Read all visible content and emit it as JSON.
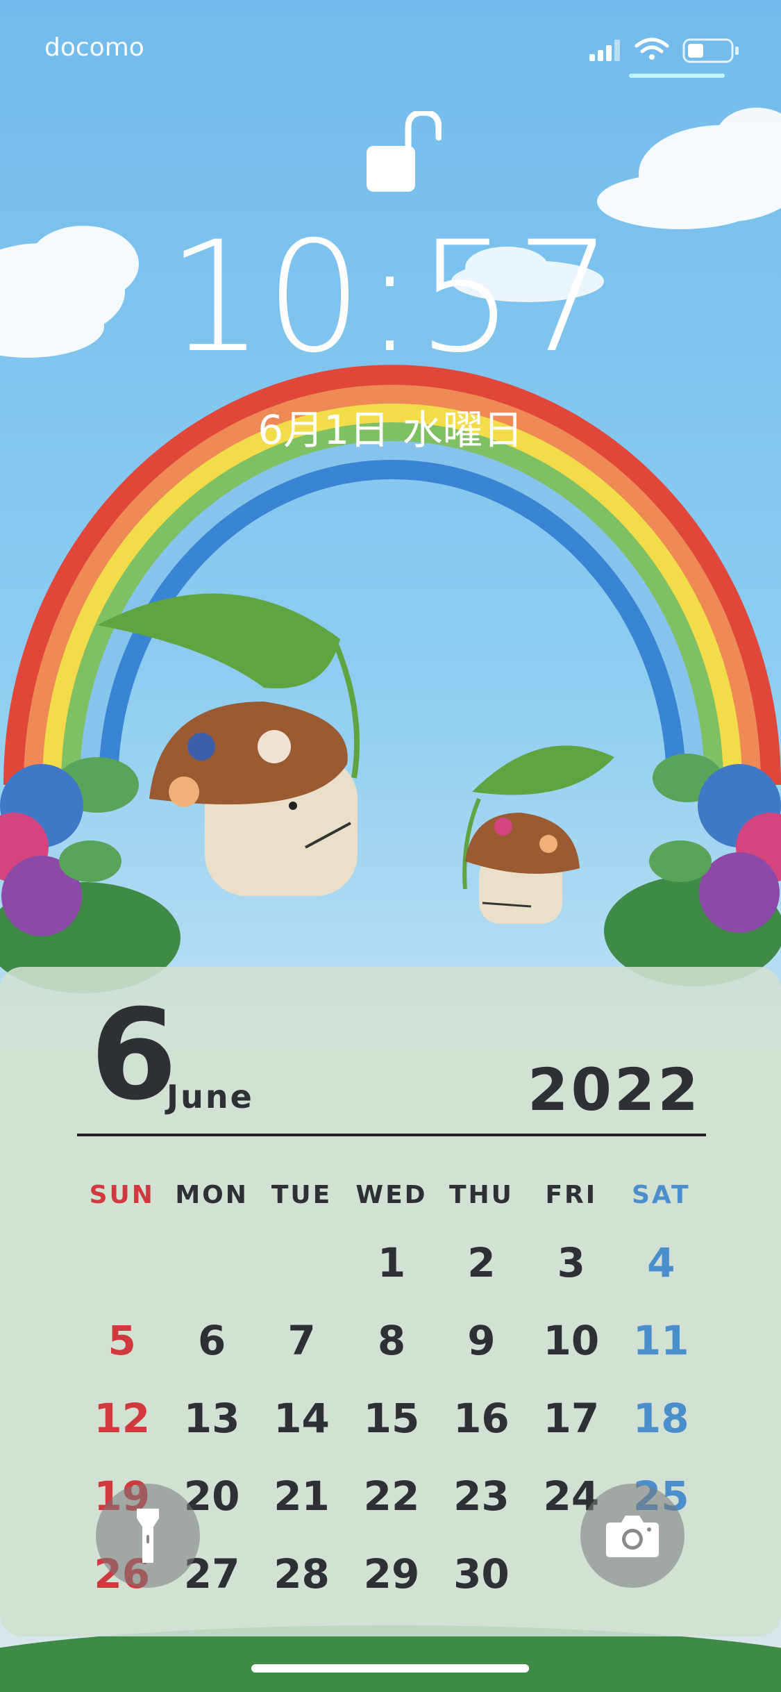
{
  "status_bar": {
    "carrier": "docomo",
    "signal_icon": "cellular-signal-icon",
    "wifi_icon": "wifi-icon",
    "battery_icon": "battery-icon"
  },
  "lock_screen": {
    "lock_icon": "unlocked-padlock-icon",
    "time": "10:57",
    "date": "6月1日 水曜日"
  },
  "calendar": {
    "month_number": "6",
    "month_name": "June",
    "year": "2022",
    "weekdays": [
      "SUN",
      "MON",
      "TUE",
      "WED",
      "THU",
      "FRI",
      "SAT"
    ],
    "weeks": [
      [
        "",
        "",
        "",
        "1",
        "2",
        "3",
        "4"
      ],
      [
        "5",
        "6",
        "7",
        "8",
        "9",
        "10",
        "11"
      ],
      [
        "12",
        "13",
        "14",
        "15",
        "16",
        "17",
        "18"
      ],
      [
        "19",
        "20",
        "21",
        "22",
        "23",
        "24",
        "25"
      ],
      [
        "26",
        "27",
        "28",
        "29",
        "30",
        "",
        ""
      ]
    ],
    "colors": {
      "sunday": "#d0393e",
      "saturday": "#4a8fcc",
      "weekday": "#2d3135"
    }
  },
  "controls": {
    "flashlight_icon": "flashlight-icon",
    "camera_icon": "camera-icon"
  }
}
